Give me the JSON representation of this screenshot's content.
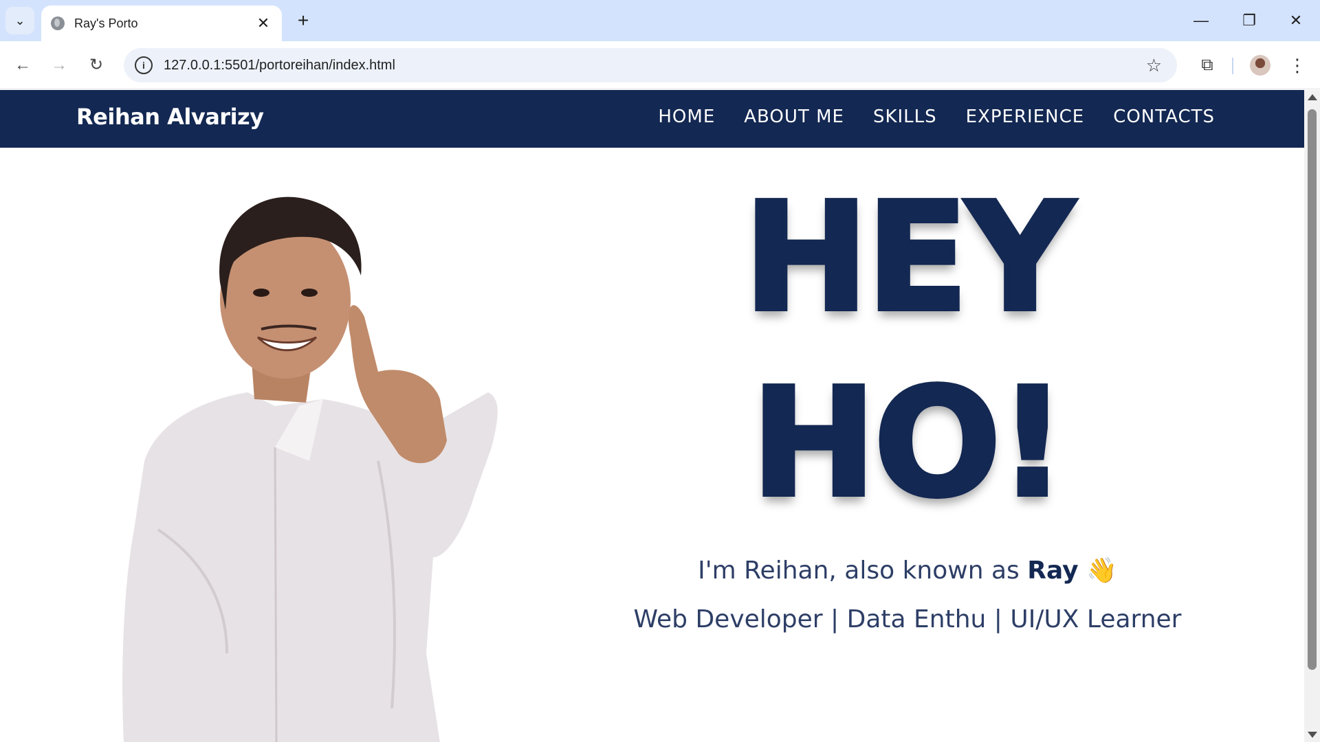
{
  "browser": {
    "tab_title": "Ray's Porto",
    "url": "127.0.0.1:5501/portoreihan/index.html"
  },
  "site": {
    "brand": "Reihan Alvarizy",
    "nav": [
      "HOME",
      "ABOUT ME",
      "SKILLS",
      "EXPERIENCE",
      "CONTACTS"
    ],
    "colors": {
      "primary": "#132852",
      "text": "#2d3e66"
    }
  },
  "hero": {
    "line1": "HEY",
    "line2": "HO!",
    "intro_prefix": "I'm Reihan, also known as ",
    "intro_name": "Ray",
    "intro_emoji": "👋",
    "roles": "Web Developer | Data Enthu | UI/UX Learner"
  }
}
